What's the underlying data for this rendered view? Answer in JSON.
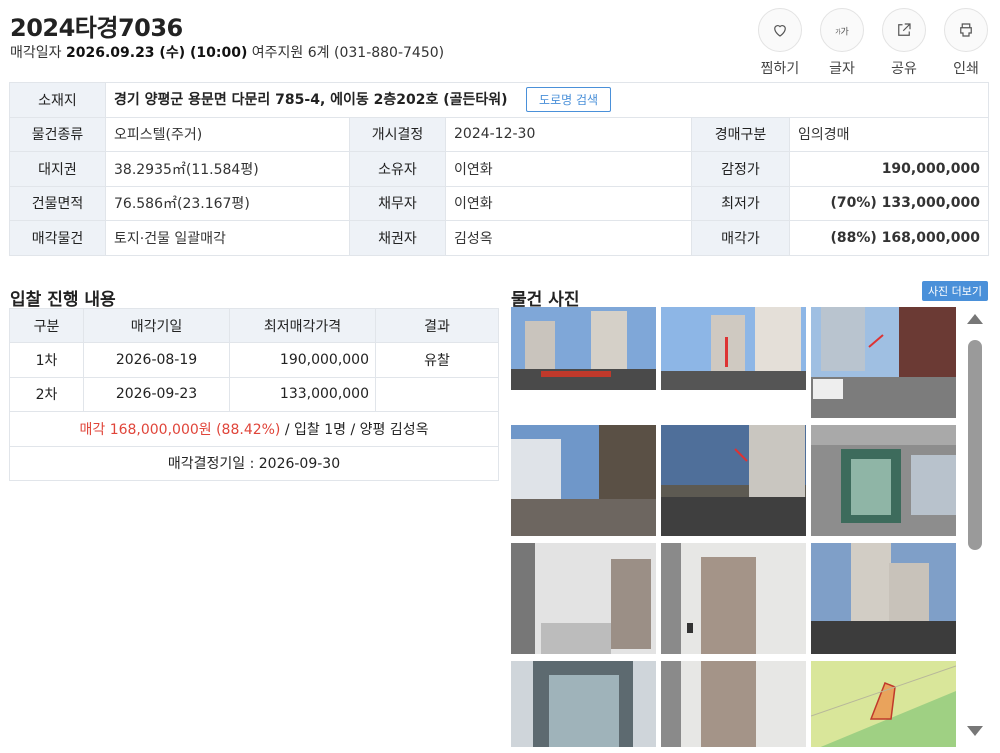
{
  "case": {
    "number": "2024타경7036",
    "sale_label": "매각일자",
    "sale_date": "2026.09.23 (수) (10:00)",
    "court": "여주지원 6계 (031-880-7450)"
  },
  "actions": [
    {
      "label": "찜하기",
      "icon": "heart-icon"
    },
    {
      "label": "글자",
      "icon": "font-size-icon"
    },
    {
      "label": "공유",
      "icon": "share-icon"
    },
    {
      "label": "인쇄",
      "icon": "print-icon"
    }
  ],
  "info": {
    "address_label": "소재지",
    "address": "경기 양평군 용문면 다문리 785-4, 에이동 2층202호 (골든타워)",
    "road_search": "도로명 검색",
    "rows": [
      {
        "k1": "물건종류",
        "v1": "오피스텔(주거)",
        "k2": "개시결정",
        "v2": "2024-12-30",
        "k3": "경매구분",
        "v3": "임의경매"
      },
      {
        "k1": "대지권",
        "v1": "38.2935㎡(11.584평)",
        "k2": "소유자",
        "v2": "이연화",
        "k3": "감정가",
        "v3": "190,000,000"
      },
      {
        "k1": "건물면적",
        "v1": "76.586㎡(23.167평)",
        "k2": "채무자",
        "v2": "이연화",
        "k3": "최저가",
        "v3": "(70%) 133,000,000"
      },
      {
        "k1": "매각물건",
        "v1": "토지·건물 일괄매각",
        "k2": "채권자",
        "v2": "김성옥",
        "k3": "매각가",
        "v3": "(88%) 168,000,000"
      }
    ],
    "colors": {
      "min_price": "#4a90d9",
      "sale_price": "#e0453a"
    }
  },
  "bidding": {
    "title": "입찰 진행 내용",
    "headers": [
      "구분",
      "매각기일",
      "최저매각가격",
      "결과"
    ],
    "rows": [
      {
        "round": "1차",
        "date": "2026-08-19",
        "price": "190,000,000",
        "result": "유찰"
      },
      {
        "round": "2차",
        "date": "2026-09-23",
        "price": "133,000,000",
        "result": ""
      }
    ],
    "sale_summary_red": "매각 168,000,000원 (88.42%)",
    "sale_summary_rest": " / 입찰 1명 / 양평 김성옥",
    "decision": "매각결정기일 : 2026-09-30"
  },
  "photos": {
    "title": "물건 사진",
    "more": "사진 더보기"
  }
}
